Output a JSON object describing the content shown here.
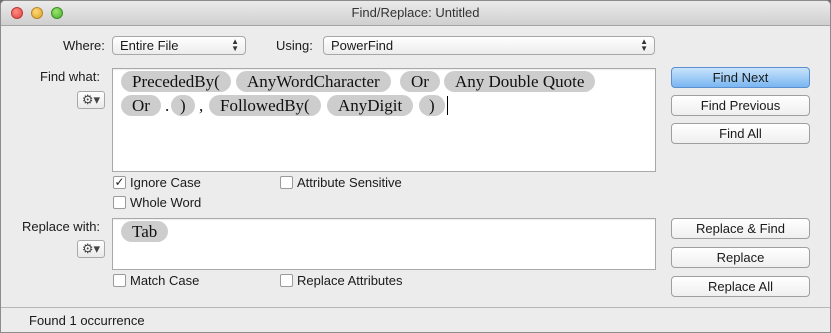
{
  "window": {
    "title": "Find/Replace: Untitled"
  },
  "where": {
    "label": "Where:",
    "value": "Entire File"
  },
  "using": {
    "label": "Using:",
    "value": "PowerFind"
  },
  "find": {
    "label": "Find what:",
    "tokens": [
      "PrecededBy(",
      "AnyWordCharacter",
      "Or",
      "Any Double Quote",
      "Or",
      ".",
      ")",
      ",",
      "FollowedBy(",
      "AnyDigit",
      ")"
    ]
  },
  "replace": {
    "label": "Replace with:",
    "tokens": [
      "Tab"
    ]
  },
  "options": {
    "ignore_case": {
      "label": "Ignore Case",
      "checked": true
    },
    "attribute_sensitive": {
      "label": "Attribute Sensitive",
      "checked": false
    },
    "whole_word": {
      "label": "Whole Word",
      "checked": false
    },
    "match_case": {
      "label": "Match Case",
      "checked": false
    },
    "replace_attributes": {
      "label": "Replace Attributes",
      "checked": false
    }
  },
  "buttons": {
    "find_next": "Find Next",
    "find_previous": "Find Previous",
    "find_all": "Find All",
    "replace_find": "Replace & Find",
    "replace": "Replace",
    "replace_all": "Replace All"
  },
  "status": "Found 1 occurrence",
  "icons": {
    "gear": "⚙▾",
    "check": "✓",
    "popup_arrow": "▲▼"
  }
}
